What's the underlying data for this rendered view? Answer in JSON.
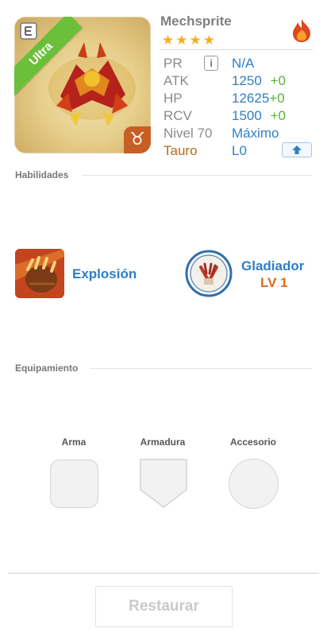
{
  "monster": {
    "name": "Mechsprite",
    "rarity_badge": "Ultra",
    "stars": "★★★★",
    "zodiac_symbol": "♉",
    "element_icon": "fire-element-icon",
    "stats": {
      "pr_label": "PR",
      "pr_value": "N/A",
      "atk_label": "ATK",
      "atk_value": "1250",
      "atk_plus": "+0",
      "hp_label": "HP",
      "hp_value": "12625",
      "hp_plus": "+0",
      "rcv_label": "RCV",
      "rcv_value": "1500",
      "rcv_plus": "+0",
      "level_label": "Nivel 70",
      "level_value": "Máximo",
      "zodiac_label": "Tauro",
      "zodiac_level": "L0"
    }
  },
  "skills": {
    "section_title": "Habilidades",
    "active_name": "Explosión",
    "leader_name": "Gladiador",
    "leader_level": "LV 1"
  },
  "equipment": {
    "section_title": "Equipamiento",
    "weapon_label": "Arma",
    "armor_label": "Armadura",
    "accessory_label": "Accesorio"
  },
  "footer": {
    "restore_label": "Restaurar"
  },
  "colors": {
    "accent_blue": "#2f7fc4",
    "green_plus": "#55b336",
    "ultra_green": "#6cbf3a",
    "level_orange": "#e46a1b"
  }
}
